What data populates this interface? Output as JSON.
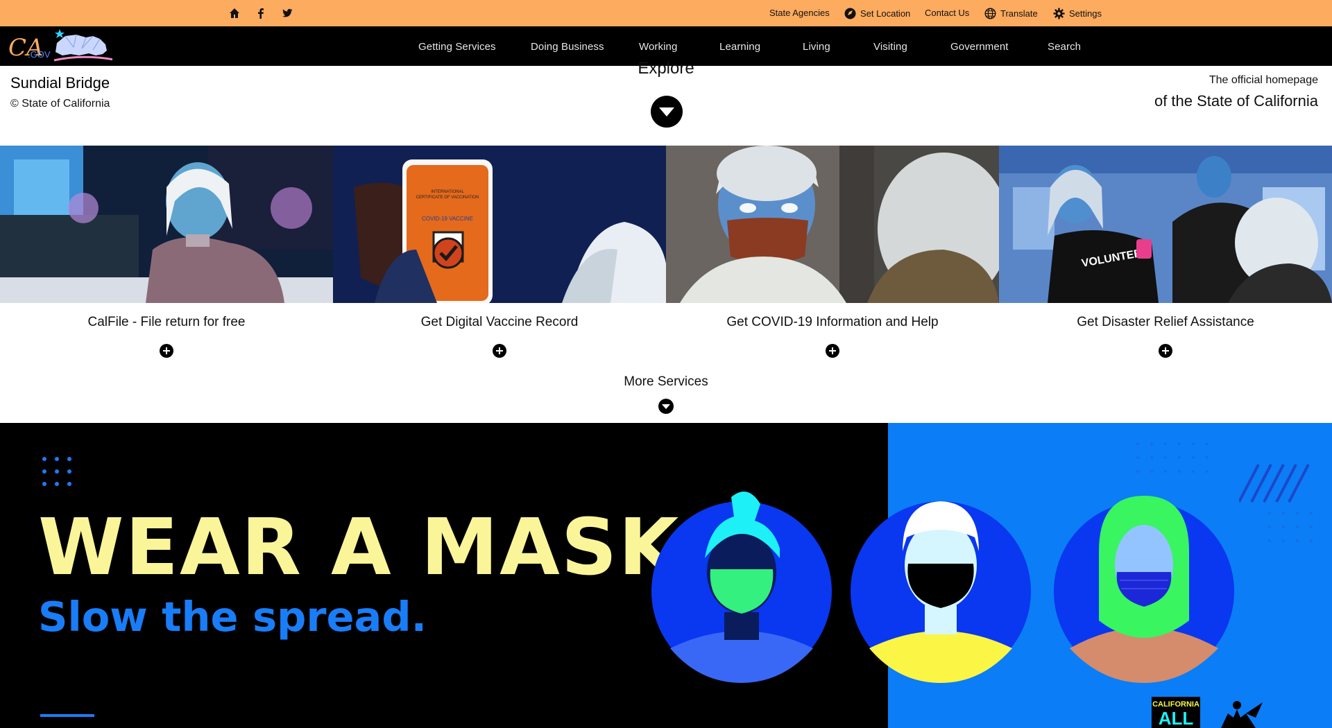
{
  "utility_bar": {
    "social": [
      "home-icon",
      "facebook-icon",
      "twitter-icon"
    ],
    "links": {
      "state_agencies": "State Agencies",
      "set_location": "Set Location",
      "contact_us": "Contact Us",
      "translate": "Translate",
      "settings": "Settings"
    }
  },
  "nav": {
    "logo_text": "CA.GOV",
    "items": [
      "Getting Services",
      "Doing Business",
      "Working",
      "Learning",
      "Living",
      "Visiting",
      "Government",
      "Search"
    ]
  },
  "explore": {
    "image_caption": "Sundial Bridge",
    "copyright": "© State of California",
    "label": "Explore",
    "official_line1": "The official homepage",
    "official_line2": "of the State of California"
  },
  "services": {
    "cards": [
      {
        "title": "CalFile - File return for free"
      },
      {
        "title": "Get Digital Vaccine Record"
      },
      {
        "title": "Get COVID-19 Information and Help"
      },
      {
        "title": "Get Disaster Relief Assistance"
      }
    ],
    "more_label": "More Services"
  },
  "banner": {
    "headline": "WEAR A MASK.",
    "subhead": "Slow the spread.",
    "logo_text_line1": "CALIFORNIA",
    "logo_text_line2": "ALL"
  },
  "colors": {
    "utility_bar": "#fcab5f",
    "nav_bar": "#000000",
    "banner_left": "#000000",
    "banner_right": "#0b7df6",
    "headline": "#fbf59a",
    "subhead": "#1a7df8"
  }
}
